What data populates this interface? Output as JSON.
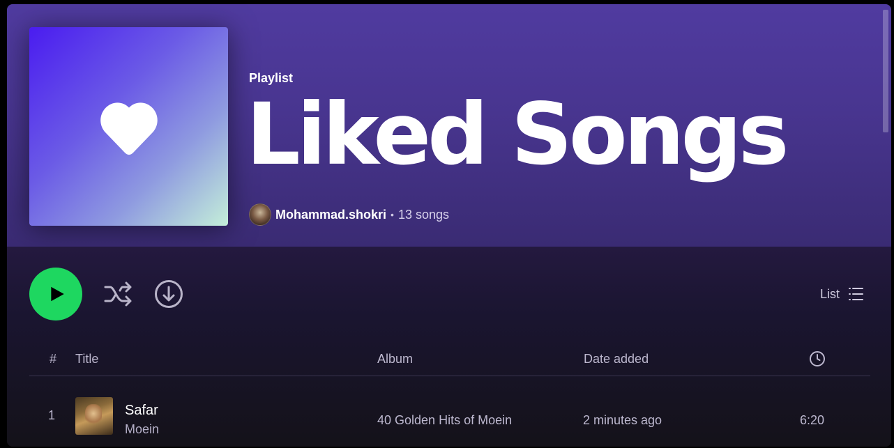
{
  "header": {
    "kind": "Playlist",
    "title": "Liked Songs",
    "owner": "Mohammad.shokri",
    "separator": "•",
    "song_count": "13 songs",
    "cover_icon": "heart-icon"
  },
  "actions": {
    "play_icon": "play-icon",
    "shuffle_icon": "shuffle-icon",
    "download_icon": "download-icon",
    "view_label": "List",
    "view_icon": "list-icon"
  },
  "table": {
    "columns": {
      "number": "#",
      "title": "Title",
      "album": "Album",
      "date_added": "Date added",
      "duration_icon": "clock-icon"
    },
    "rows": [
      {
        "number": "1",
        "title": "Safar",
        "artist": "Moein",
        "album": "40 Golden Hits of Moein",
        "date_added": "2 minutes ago",
        "duration": "6:20"
      }
    ]
  },
  "colors": {
    "accent_green": "#1ed760",
    "header_purple": "#503ba0",
    "background": "#121019"
  }
}
